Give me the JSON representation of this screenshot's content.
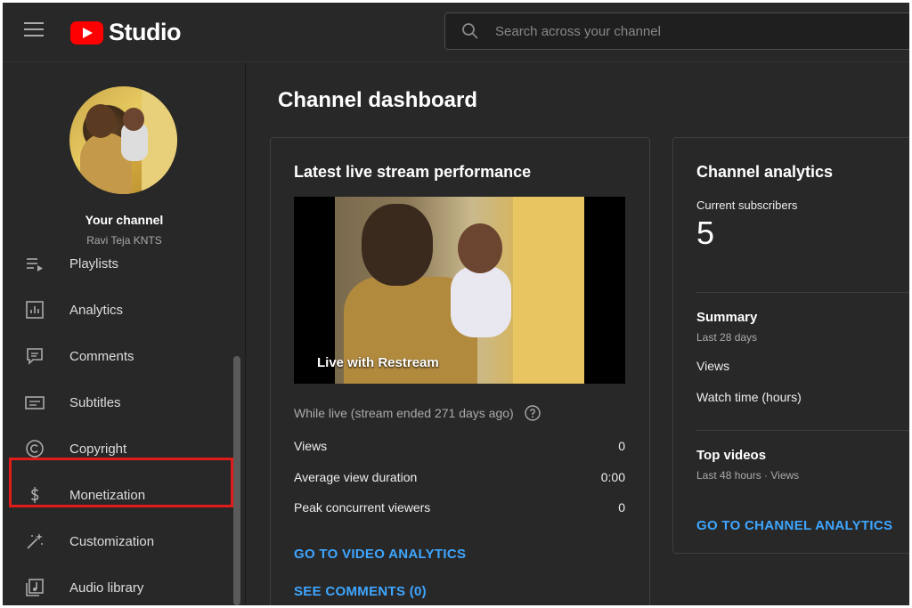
{
  "header": {
    "logo_text": "Studio",
    "search_placeholder": "Search across your channel"
  },
  "sidebar": {
    "your_channel": "Your channel",
    "channel_name": "Ravi Teja KNTS",
    "items": [
      {
        "label": "Playlists",
        "icon": "playlists-icon"
      },
      {
        "label": "Analytics",
        "icon": "analytics-icon"
      },
      {
        "label": "Comments",
        "icon": "comments-icon"
      },
      {
        "label": "Subtitles",
        "icon": "subtitles-icon"
      },
      {
        "label": "Copyright",
        "icon": "copyright-icon"
      },
      {
        "label": "Monetization",
        "icon": "monetization-icon"
      },
      {
        "label": "Customization",
        "icon": "customization-icon"
      },
      {
        "label": "Audio library",
        "icon": "audio-library-icon"
      }
    ]
  },
  "main": {
    "page_title": "Channel dashboard",
    "live_card": {
      "title": "Latest live stream performance",
      "thumbnail_label": "Live with Restream",
      "status": "While live (stream ended 271 days ago)",
      "stats": [
        {
          "label": "Views",
          "value": "0"
        },
        {
          "label": "Average view duration",
          "value": "0:00"
        },
        {
          "label": "Peak concurrent viewers",
          "value": "0"
        }
      ],
      "link_analytics": "GO TO VIDEO ANALYTICS",
      "link_comments": "SEE COMMENTS (0)"
    },
    "analytics_card": {
      "title": "Channel analytics",
      "subscribers_label": "Current subscribers",
      "subscribers_value": "5",
      "summary_title": "Summary",
      "summary_period": "Last 28 days",
      "summary_views": "Views",
      "summary_watch_time": "Watch time (hours)",
      "top_videos_title": "Top videos",
      "top_videos_period": "Last 48 hours · Views",
      "link": "GO TO CHANNEL ANALYTICS"
    }
  },
  "colors": {
    "background": "#282828",
    "link": "#3ea6ff",
    "brand_red": "#ff0000",
    "highlight": "#e11a1a"
  }
}
